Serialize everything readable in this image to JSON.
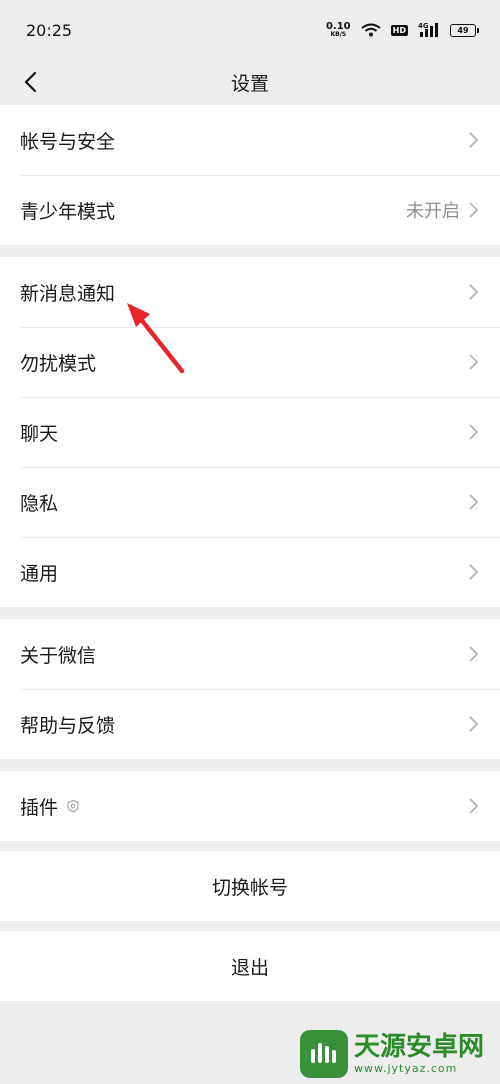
{
  "status_bar": {
    "time": "20:25",
    "net_speed": "0.10",
    "net_unit": "KB/S",
    "hd": "HD",
    "signal_type": "4G",
    "battery": "49"
  },
  "header": {
    "title": "设置"
  },
  "groups": [
    {
      "items": [
        {
          "label": "帐号与安全"
        },
        {
          "label": "青少年模式",
          "value": "未开启"
        }
      ]
    },
    {
      "items": [
        {
          "label": "新消息通知"
        },
        {
          "label": "勿扰模式"
        },
        {
          "label": "聊天"
        },
        {
          "label": "隐私"
        },
        {
          "label": "通用"
        }
      ]
    },
    {
      "items": [
        {
          "label": "关于微信"
        },
        {
          "label": "帮助与反馈"
        }
      ]
    },
    {
      "items": [
        {
          "label": "插件",
          "badge_icon": "plugin-shield-icon"
        }
      ]
    }
  ],
  "actions": {
    "switch_account": "切换帐号",
    "logout": "退出"
  },
  "annotation": {
    "arrow_color": "#e8262a",
    "target": "新消息通知"
  },
  "watermark": {
    "title": "天源安卓网",
    "url": "www.jytyaz.com"
  }
}
